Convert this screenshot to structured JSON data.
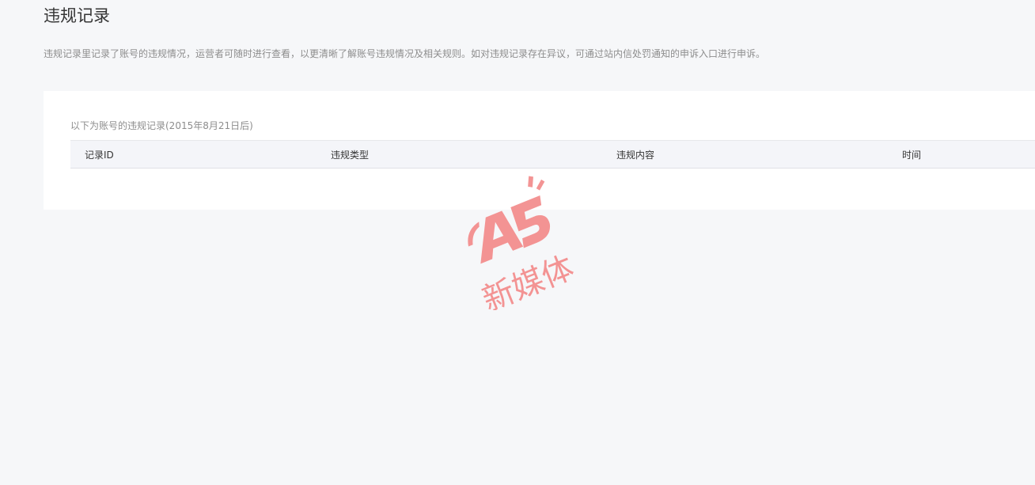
{
  "page": {
    "title": "违规记录",
    "description": "违规记录里记录了账号的违规情况，运营者可随时进行查看，以更清晰了解账号违规情况及相关规则。如对违规记录存在异议，可通过站内信处罚通知的申诉入口进行申诉。"
  },
  "records": {
    "caption": "以下为账号的违规记录(2015年8月21日后)",
    "columns": [
      "记录ID",
      "违规类型",
      "违规内容",
      "时间"
    ],
    "rows": []
  },
  "watermark": {
    "logo_text": "A5",
    "text": "新媒体",
    "color": "#f38b8b"
  }
}
